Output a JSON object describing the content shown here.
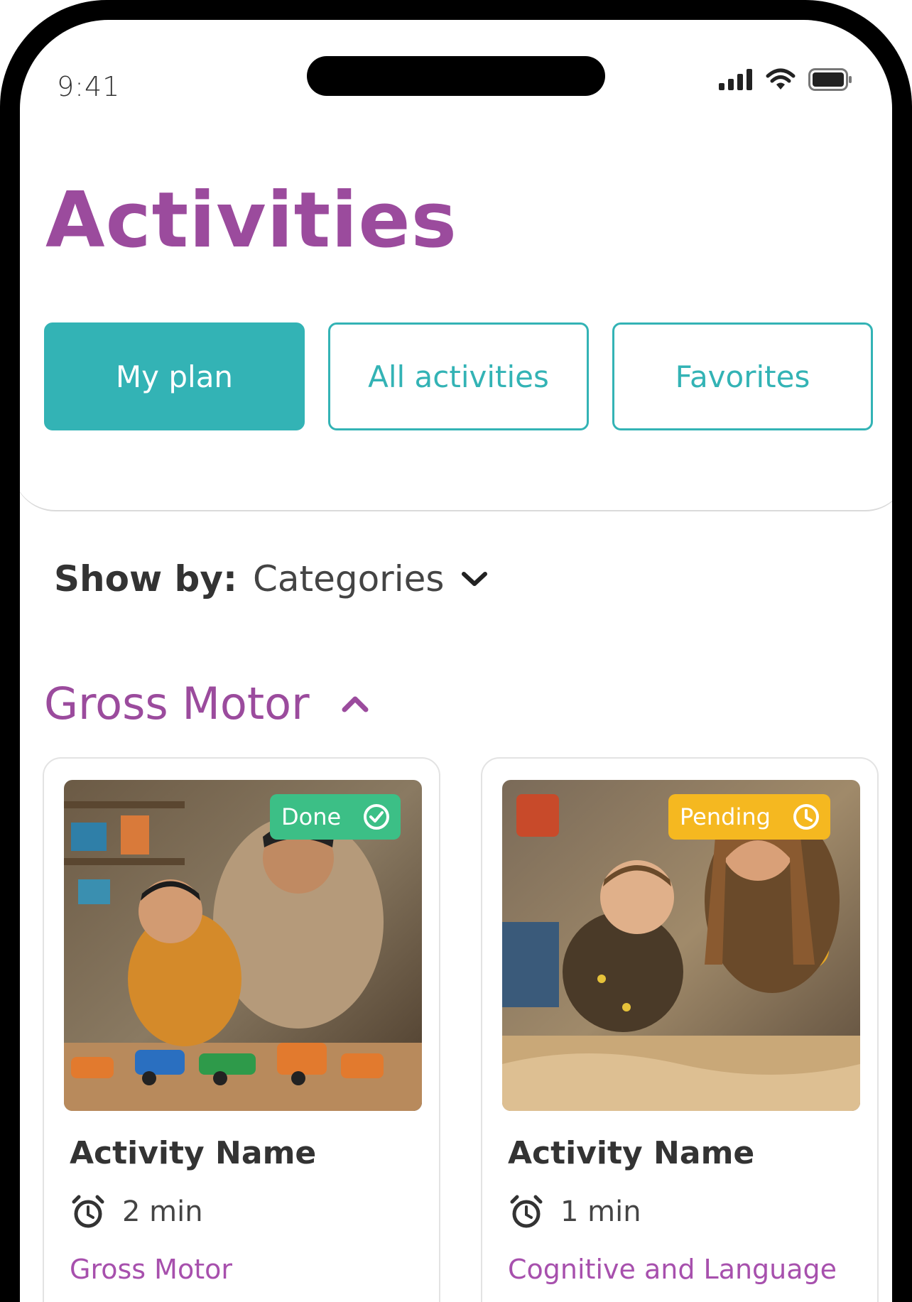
{
  "status_bar": {
    "time": "9:41"
  },
  "page": {
    "title": "Activities"
  },
  "tabs": [
    {
      "label": "My plan",
      "active": true
    },
    {
      "label": "All activities",
      "active": false
    },
    {
      "label": "Favorites",
      "active": false
    }
  ],
  "filter": {
    "label": "Show by:",
    "value": "Categories"
  },
  "section": {
    "title": "Gross Motor",
    "expanded": true
  },
  "cards": [
    {
      "status": "Done",
      "status_color": "#3cbf86",
      "name": "Activity Name",
      "duration": "2 min",
      "category": "Gross Motor"
    },
    {
      "status": "Pending",
      "status_color": "#f5b820",
      "name": "Activity Name",
      "duration": "1 min",
      "category": "Cognitive and Language Skills"
    }
  ],
  "colors": {
    "brand_purple": "#9b4b9d",
    "teal": "#33b3b5",
    "category_purple": "#a750ad"
  }
}
